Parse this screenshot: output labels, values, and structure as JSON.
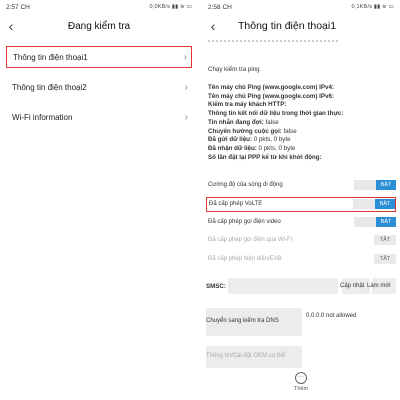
{
  "left": {
    "status": {
      "time": "2:57 CH",
      "icons": "0,0KB/s ▮▮ ≋ ▭"
    },
    "title": "Đang kiểm tra",
    "items": [
      {
        "label": "Thông tin điện thoại1"
      },
      {
        "label": "Thông tin điện thoại2"
      },
      {
        "label": "Wi-Fi information"
      }
    ]
  },
  "right": {
    "status": {
      "time": "2:58 CH",
      "icons": "0,1KB/s ▮▮ ≋ ▭"
    },
    "title": "Thông tin điện thoại1",
    "ping_button": "Chạy kiểm tra ping",
    "info_lines": [
      {
        "text": "Tên máy chủ Ping (www.google.com) IPv4:",
        "bold": true
      },
      {
        "text": "Tên máy chủ Ping (www.google.com) IPv6:",
        "bold": true
      },
      {
        "text": "Kiểm tra máy khách HTTP:",
        "bold": true
      },
      {
        "text": "Thông tin kết nối dữ liệu trong thời gian thực:",
        "bold": true
      },
      {
        "label": "Tin nhắn đang đợi:",
        "value": " false"
      },
      {
        "label": "Chuyển hướng cuộc gọi:",
        "value": " false"
      },
      {
        "label": "Đã gửi dữ liệu:",
        "value": " 0 pkts, 0 byte"
      },
      {
        "label": "Đã nhận dữ liệu:",
        "value": " 0 pkts, 0 byte"
      },
      {
        "text": "Số lần đặt lại PPP kể từ khi khởi động:",
        "bold": true
      }
    ],
    "toggles": [
      {
        "label": "Cường độ của sóng di động",
        "state": "BẬT",
        "active": true
      },
      {
        "label": "Đã cấp phép VoLTE",
        "state": "BẬT",
        "active": true
      },
      {
        "label": "Đã cấp phép gọi điện video",
        "state": "BẬT",
        "active": true
      },
      {
        "label": "Đã cấp phép gọi điện qua Wi-Fi",
        "state": "TẮT",
        "active": false
      },
      {
        "label": "Đã cấp phép hiện diện/EAB",
        "state": "TẮT",
        "active": false
      }
    ],
    "smsc": {
      "label": "SMSC:",
      "refresh": "Cập nhật",
      "update": "Làm mới"
    },
    "dns": {
      "label": "Chuyển sang kiểm tra DNS",
      "value": "0.0.0.0 not allowed"
    },
    "oem": "Thông tin/Cài đặt OEM cụ thể",
    "more": "Thêm",
    "colors": {
      "accent": "#2b8fd8",
      "highlight": "#dd3333"
    }
  }
}
